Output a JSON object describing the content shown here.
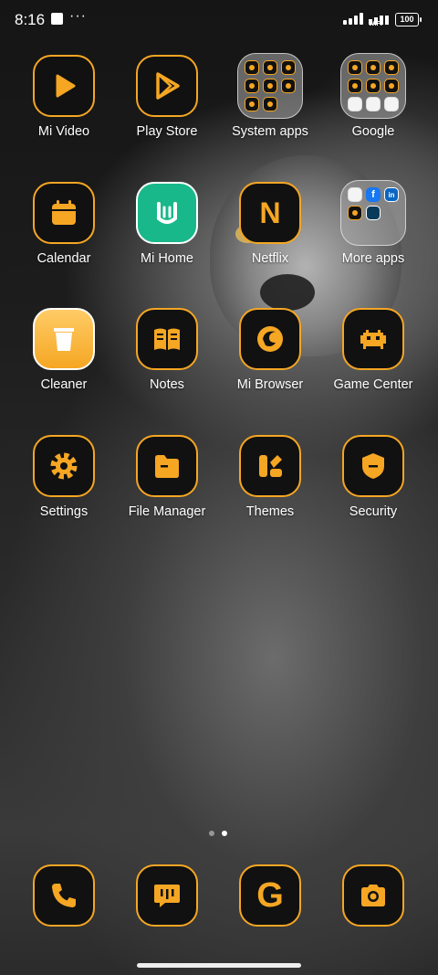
{
  "status_bar": {
    "time": "8:16",
    "dots": "···",
    "wifi_label": "WIFI",
    "battery": "100"
  },
  "apps": [
    {
      "label": "Mi Video",
      "icon": "play-icon"
    },
    {
      "label": "Play Store",
      "icon": "play-store-icon"
    },
    {
      "label": "System apps",
      "icon": "folder-icon"
    },
    {
      "label": "Google",
      "icon": "folder-icon"
    },
    {
      "label": "Calendar",
      "icon": "calendar-icon"
    },
    {
      "label": "Mi Home",
      "icon": "mi-home-icon"
    },
    {
      "label": "Netflix",
      "icon": "netflix-icon",
      "glyph": "N"
    },
    {
      "label": "More apps",
      "icon": "folder-icon"
    },
    {
      "label": "Cleaner",
      "icon": "trash-icon"
    },
    {
      "label": "Notes",
      "icon": "book-icon"
    },
    {
      "label": "Mi Browser",
      "icon": "browser-icon"
    },
    {
      "label": "Game Center",
      "icon": "space-invader-icon"
    },
    {
      "label": "Settings",
      "icon": "gear-icon"
    },
    {
      "label": "File Manager",
      "icon": "folder-file-icon"
    },
    {
      "label": "Themes",
      "icon": "themes-icon"
    },
    {
      "label": "Security",
      "icon": "shield-icon"
    }
  ],
  "dock": [
    {
      "icon": "phone-icon"
    },
    {
      "icon": "message-icon"
    },
    {
      "icon": "google-icon",
      "glyph": "G"
    },
    {
      "icon": "camera-icon"
    }
  ],
  "colors": {
    "accent": "#f5a623",
    "icon_bg": "#111111",
    "mi_home": "#19b88a"
  },
  "pages": {
    "count": 2,
    "current": 2
  }
}
